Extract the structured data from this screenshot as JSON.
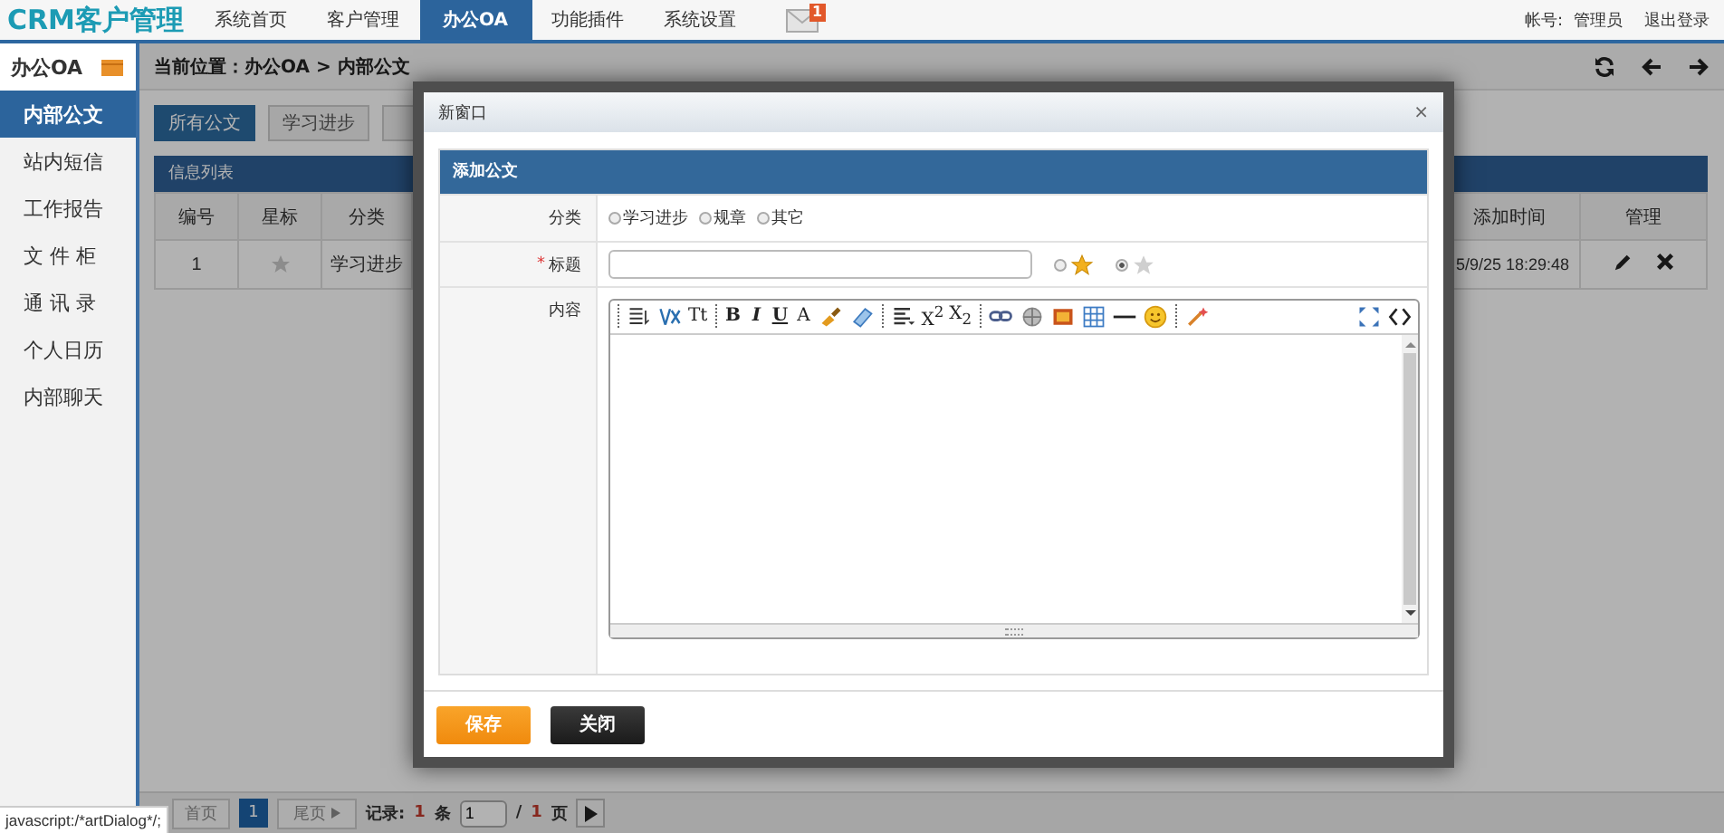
{
  "logo": "CRM客户管理",
  "nav": {
    "tabs": [
      {
        "label": "系统首页",
        "selected": false
      },
      {
        "label": "客户管理",
        "selected": false
      },
      {
        "label": "办公OA",
        "selected": true
      },
      {
        "label": "功能插件",
        "selected": false
      },
      {
        "label": "系统设置",
        "selected": false
      }
    ],
    "mail_badge": "1"
  },
  "account": {
    "label": "帐号:",
    "user": "管理员",
    "logout": "退出登录"
  },
  "sidebar": {
    "title": "办公OA",
    "items": [
      {
        "label": "内部公文",
        "selected": true
      },
      {
        "label": "站内短信",
        "selected": false
      },
      {
        "label": "工作报告",
        "selected": false
      },
      {
        "label": "文 件 柜",
        "selected": false
      },
      {
        "label": "通 讯 录",
        "selected": false
      },
      {
        "label": "个人日历",
        "selected": false
      },
      {
        "label": "内部聊天",
        "selected": false
      }
    ]
  },
  "breadcrumb": "当前位置：办公OA > 内部公文",
  "filters": [
    {
      "label": "所有公文",
      "selected": true
    },
    {
      "label": "学习进步",
      "selected": false
    }
  ],
  "table": {
    "title": "信息列表",
    "columns": [
      "编号",
      "星标",
      "分类",
      "",
      "添加时间",
      "管理"
    ],
    "rows": [
      {
        "cells": [
          "1",
          "",
          "学习进步",
          "",
          "5/9/25 18:29:48",
          ""
        ],
        "starred": false
      }
    ]
  },
  "pagination": {
    "first": {
      "label": "首页",
      "disabled": true
    },
    "pages": [
      {
        "label": "1",
        "selected": true
      }
    ],
    "last": {
      "label": "尾页",
      "disabled": true
    },
    "records_label": "记录:",
    "records": "1",
    "records_unit": "条",
    "page_input": "1",
    "slash": "/",
    "total_pages": "1",
    "pages_unit": "页"
  },
  "dialog": {
    "title": "新窗口",
    "close": "×",
    "panel_title": "添加公文",
    "category": {
      "label": "分类",
      "options": [
        {
          "label": "学习进步",
          "selected": false
        },
        {
          "label": "规章",
          "selected": false
        },
        {
          "label": "其它",
          "selected": false
        }
      ]
    },
    "title_field": {
      "required_mark": "*",
      "label": "标题",
      "star_options": [
        {
          "selected": false,
          "starred": true
        },
        {
          "selected": true,
          "starred": false
        }
      ]
    },
    "content": {
      "label": "内容",
      "toolbar_left": [
        {
          "kind": "separator"
        },
        {
          "kind": "icon"
        },
        {
          "kind": "icon"
        },
        {
          "kind": "glyph",
          "text": "Tt"
        },
        {
          "kind": "separator"
        },
        {
          "kind": "glyph",
          "text": "B"
        },
        {
          "kind": "glyph",
          "text": "I"
        },
        {
          "kind": "glyph",
          "text": "U"
        },
        {
          "kind": "glyph",
          "text": "A"
        },
        {
          "kind": "icon"
        },
        {
          "kind": "icon"
        },
        {
          "kind": "separator"
        },
        {
          "kind": "icon"
        },
        {
          "kind": "glyph",
          "text": "X$^{2}$"
        },
        {
          "kind": "glyph",
          "text": "X$_{2}$"
        },
        {
          "kind": "separator"
        },
        {
          "kind": "icon"
        },
        {
          "kind": "icon"
        },
        {
          "kind": "icon"
        },
        {
          "kind": "icon"
        },
        {
          "kind": "icon"
        },
        {
          "kind": "icon"
        },
        {
          "kind": "separator"
        },
        {
          "kind": "icon"
        }
      ],
      "toolbar_right": [
        {
          "kind": "icon"
        },
        {
          "kind": "icon"
        }
      ]
    },
    "buttons": [
      {
        "label": "保存",
        "kind": "primary"
      },
      {
        "label": "关闭",
        "kind": "dark"
      }
    ]
  },
  "status_tooltip": "javascript:/*artDialog*/;"
}
